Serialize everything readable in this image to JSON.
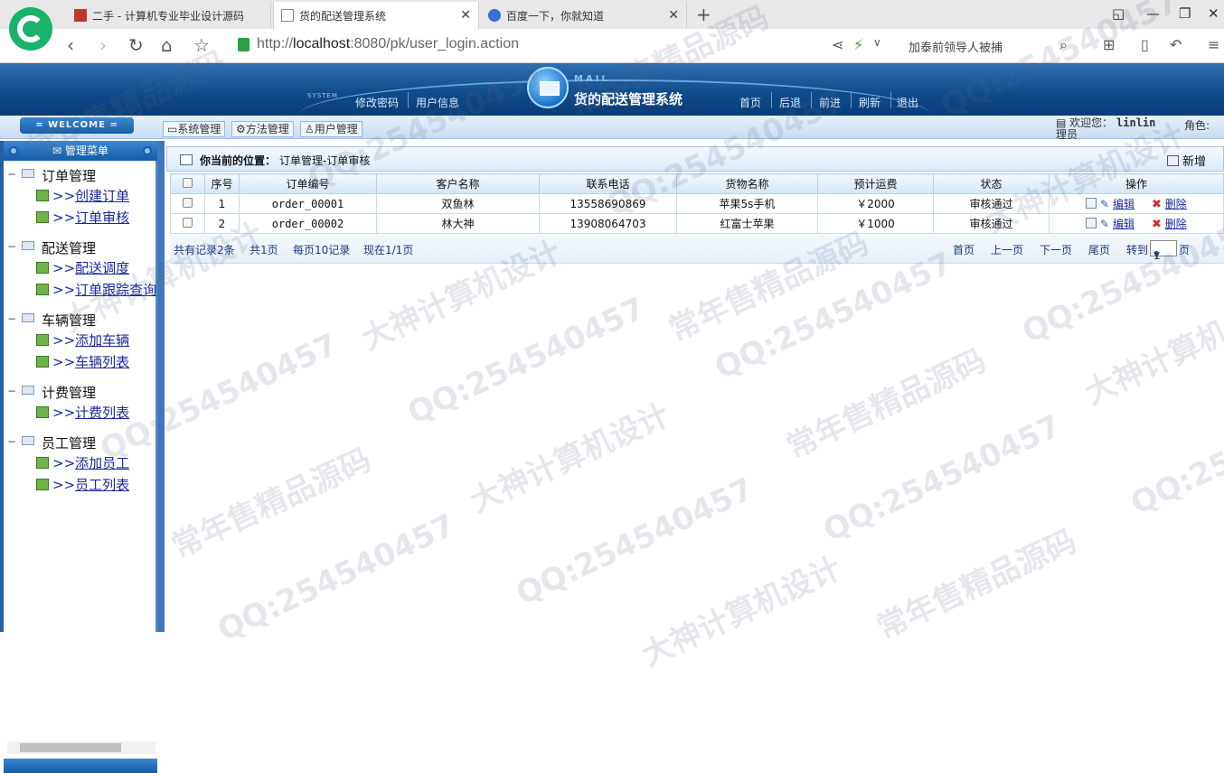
{
  "browser": {
    "tabs": [
      {
        "label": "二手 - 计算机专业毕业设计源码"
      },
      {
        "label": "货的配送管理系统"
      },
      {
        "label": "百度一下，你就知道"
      }
    ],
    "url_prefix": "http://",
    "url_host": "localhost",
    "url_rest": ":8080/pk/user_login.action",
    "news": "加泰前领导人被捕"
  },
  "header": {
    "system_tag": "SYSTEM",
    "left_links": [
      "修改密码",
      "用户信息"
    ],
    "mail_tag": "MAIL",
    "title": "货的配送管理系统",
    "right_links": [
      "首页",
      "后退",
      "前进",
      "刷新",
      "退出"
    ]
  },
  "welcome": {
    "badge": "= WELCOME =",
    "tabs": [
      "系统管理",
      "方法管理",
      "用户管理"
    ],
    "greeting": "欢迎您：",
    "username": "linlin",
    "role_label": "角色:",
    "role_overflow": "理员"
  },
  "sidebar": {
    "title": "管理菜单",
    "groups": [
      {
        "name": "订单管理",
        "items": [
          "创建订单",
          "订单审核"
        ]
      },
      {
        "name": "配送管理",
        "items": [
          "配送调度",
          "订单跟踪查询"
        ]
      },
      {
        "name": "车辆管理",
        "items": [
          "添加车辆",
          "车辆列表"
        ]
      },
      {
        "name": "计费管理",
        "items": [
          "计费列表"
        ]
      },
      {
        "name": "员工管理",
        "items": [
          "添加员工",
          "员工列表"
        ]
      }
    ],
    "item_prefix": ">>"
  },
  "main": {
    "crumb_label": "你当前的位置：",
    "crumb_path": "订单管理-订单审核",
    "add_label": "新增",
    "columns": [
      "序号",
      "订单编号",
      "客户名称",
      "联系电话",
      "货物名称",
      "预计运费",
      "状态",
      "操作"
    ],
    "rows": [
      {
        "no": "1",
        "order": "order_00001",
        "customer": "双鱼林",
        "phone": "13558690869",
        "goods": "苹果5s手机",
        "fee": "￥2000",
        "status": "审核通过"
      },
      {
        "no": "2",
        "order": "order_00002",
        "customer": "林大神",
        "phone": "13908064703",
        "goods": "红富士苹果",
        "fee": "￥1000",
        "status": "审核通过"
      }
    ],
    "edit_label": "编辑",
    "delete_label": "删除",
    "pager": {
      "total": "共有记录2条",
      "pages": "共1页",
      "per_page": "每页10记录",
      "current": "现在1/1页",
      "first": "首页",
      "prev": "上一页",
      "next": "下一页",
      "last": "尾页",
      "goto": "转到",
      "goto_value": "1",
      "page_suffix": "页"
    }
  },
  "watermarks": [
    "QQ:254540457",
    "大神计算机设计",
    "常年售精品源码"
  ]
}
